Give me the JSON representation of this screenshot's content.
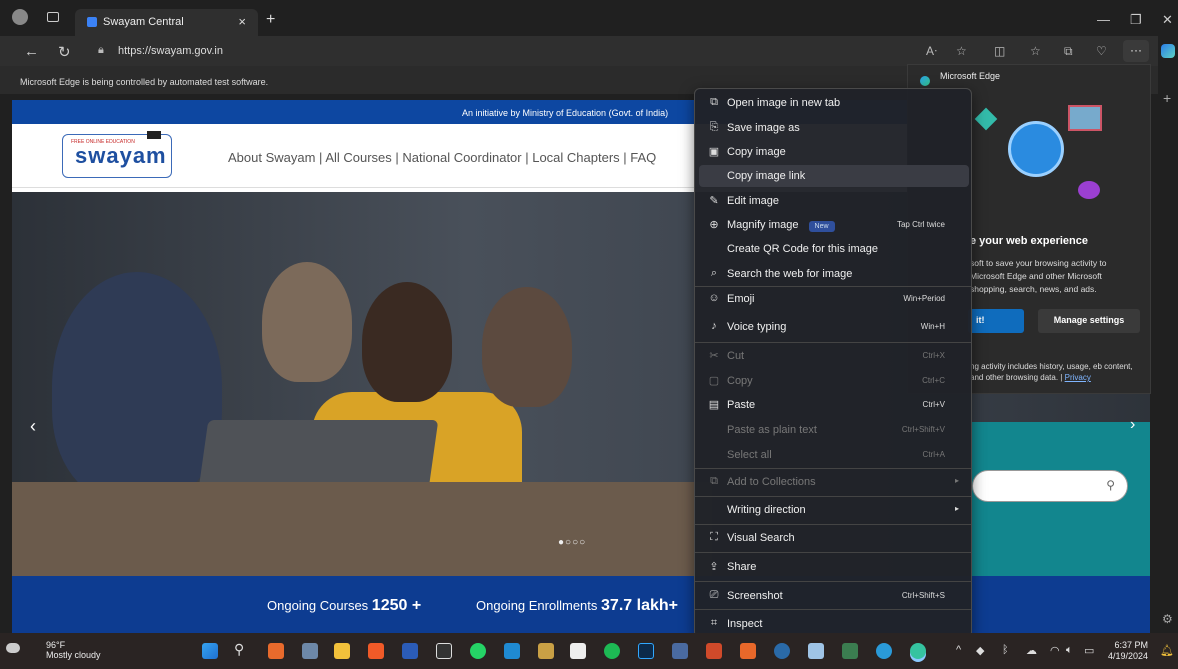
{
  "browser": {
    "tab_title": "Swayam Central",
    "tab_close": "×",
    "new_tab": "+",
    "url": "https://swayam.gov.in",
    "infobar": "Microsoft Edge is being controlled by automated test software."
  },
  "site": {
    "initiative": "An initiative by Ministry of Education (Govt. of India)",
    "logo_tag": "FREE ONLINE EDUCATION",
    "logo_text": "swayam",
    "nav": "About Swayam | All Courses | National Coordinator | Local Chapters | FAQ",
    "dots": "●○○○",
    "stats": {
      "courses_label": "Ongoing Courses",
      "courses_value": "1250 +",
      "enroll_label": "Ongoing Enrollments",
      "enroll_value": "37.7 lakh+"
    }
  },
  "promo": {
    "header": "Microsoft Edge",
    "heading": "e your web experience",
    "body": "soft to save your browsing activity to Microsoft Edge and other Microsoft shopping, search, news, and ads.",
    "btn_accept": "it!",
    "btn_manage": "Manage settings",
    "foot": "ng activity includes history, usage, eb content, and other browsing data.",
    "privacy": "Privacy"
  },
  "context_menu": {
    "items": [
      {
        "label": "Open image in new tab",
        "shortcut": "",
        "icon": "open-tab-icon"
      },
      {
        "label": "Save image as",
        "shortcut": "",
        "icon": "save-icon"
      },
      {
        "label": "Copy image",
        "shortcut": "",
        "icon": "copy-image-icon"
      },
      {
        "label": "Copy image link",
        "shortcut": "",
        "icon": ""
      },
      {
        "label": "Edit image",
        "shortcut": "",
        "icon": "edit-image-icon"
      },
      {
        "label": "Magnify image",
        "shortcut": "Tap Ctrl twice",
        "badge": "New",
        "icon": "magnify-icon"
      },
      {
        "label": "Create QR Code for this image",
        "shortcut": "",
        "icon": ""
      },
      {
        "label": "Search the web for image",
        "shortcut": "",
        "icon": "search-web-icon"
      },
      {
        "label": "Emoji",
        "shortcut": "Win+Period",
        "icon": "emoji-icon"
      },
      {
        "label": "Voice typing",
        "shortcut": "Win+H",
        "icon": "microphone-icon"
      },
      {
        "label": "Cut",
        "shortcut": "Ctrl+X",
        "icon": "cut-icon"
      },
      {
        "label": "Copy",
        "shortcut": "Ctrl+C",
        "icon": "copy-icon"
      },
      {
        "label": "Paste",
        "shortcut": "Ctrl+V",
        "icon": "paste-icon"
      },
      {
        "label": "Paste as plain text",
        "shortcut": "Ctrl+Shift+V",
        "icon": ""
      },
      {
        "label": "Select all",
        "shortcut": "Ctrl+A",
        "icon": ""
      },
      {
        "label": "Add to Collections",
        "shortcut": "",
        "icon": "collections-icon"
      },
      {
        "label": "Writing direction",
        "shortcut": "",
        "icon": ""
      },
      {
        "label": "Visual Search",
        "shortcut": "",
        "icon": "visual-search-icon"
      },
      {
        "label": "Share",
        "shortcut": "",
        "icon": "share-icon"
      },
      {
        "label": "Screenshot",
        "shortcut": "Ctrl+Shift+S",
        "icon": "screenshot-icon"
      },
      {
        "label": "Inspect",
        "shortcut": "",
        "icon": "inspect-icon"
      }
    ]
  },
  "taskbar": {
    "temp": "96°F",
    "weather": "Mostly cloudy",
    "time": "6:37 PM",
    "date": "4/19/2024"
  }
}
